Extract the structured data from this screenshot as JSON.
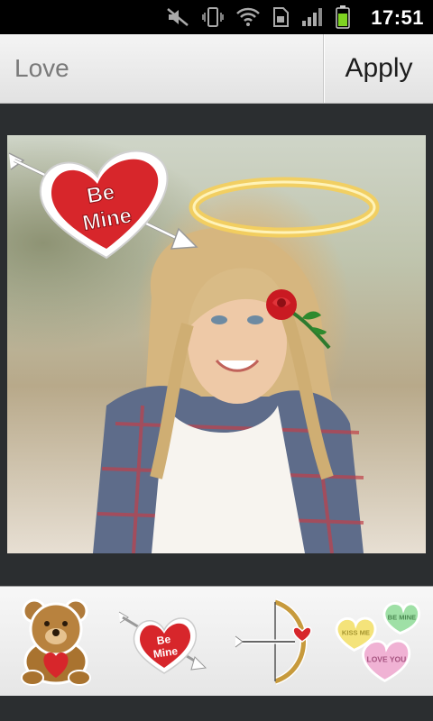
{
  "status_bar": {
    "time": "17:51",
    "icons": [
      "mute-icon",
      "vibrate-icon",
      "wifi-icon",
      "sim-icon",
      "signal-icon",
      "battery-icon"
    ]
  },
  "action_bar": {
    "title": "Love",
    "apply_label": "Apply"
  },
  "photo": {
    "stickers": [
      {
        "name": "be-mine-heart-arrow",
        "text_line1": "Be",
        "text_line2": "Mine"
      },
      {
        "name": "halo"
      },
      {
        "name": "rose"
      }
    ]
  },
  "tray": {
    "items": [
      {
        "name": "teddy-bear-sticker"
      },
      {
        "name": "be-mine-sticker",
        "text_line1": "Be",
        "text_line2": "Mine"
      },
      {
        "name": "bow-arrow-sticker"
      },
      {
        "name": "candy-hearts-sticker",
        "texts": [
          "KISS ME",
          "BE MINE",
          "LOVE YOU"
        ]
      }
    ]
  },
  "colors": {
    "accent_red": "#d7262b",
    "background": "#2b2e30",
    "battery_green": "#7ed321"
  }
}
